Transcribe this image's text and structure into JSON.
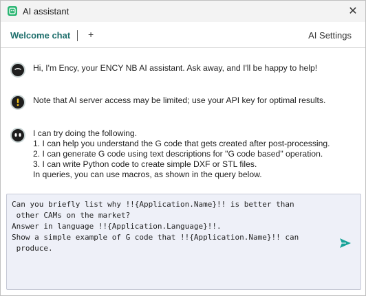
{
  "window": {
    "title": "AI assistant",
    "close_glyph": "✕",
    "app_icon": "assistant-app-icon",
    "accent_color": "#2bb673"
  },
  "tabs": {
    "active_label": "Welcome chat",
    "add_label": "+",
    "settings_label": "AI Settings",
    "active_color": "#1e6f6c"
  },
  "messages": [
    {
      "icon": "bot-face-icon",
      "lines": [
        "Hi, I'm Ency, your ENCY NB AI assistant. Ask away, and I'll be happy to help!"
      ]
    },
    {
      "icon": "warning-icon",
      "lines": [
        "Note that AI server access may be limited; use your API key for optimal results."
      ]
    },
    {
      "icon": "bot-eyes-icon",
      "lines": [
        "I can try doing the following.",
        "1. I can help you understand the G code that gets created after post-processing.",
        "2. I can generate G code using text descriptions for \"G code based\" operation.",
        "3. I can write Python code to create simple DXF or STL files.",
        "In queries, you can use macros, as shown in the query below."
      ]
    }
  ],
  "composer": {
    "text": "Can you briefly list why !!{Application.Name}!! is better than\n other CAMs on the market?\nAnswer in language !!{Application.Language}!!.\nShow a simple example of G code that !!{Application.Name}!! can\n produce.",
    "send_icon": "send-arrow-icon",
    "send_color": "#17a398"
  }
}
